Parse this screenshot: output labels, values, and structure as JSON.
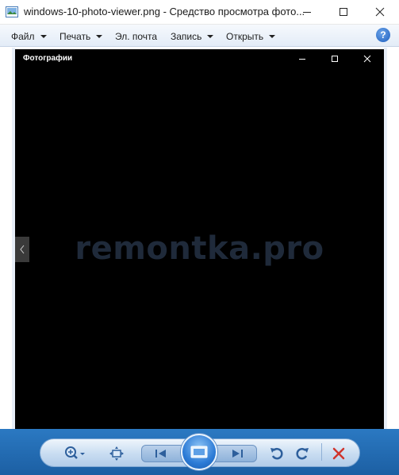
{
  "window": {
    "title": "windows-10-photo-viewer.png - Средство просмотра фото...",
    "icon": "photo-viewer-app-icon"
  },
  "menu": {
    "items": [
      {
        "label": "Файл"
      },
      {
        "label": "Печать"
      },
      {
        "label": "Эл. почта"
      },
      {
        "label": "Запись"
      },
      {
        "label": "Открыть"
      }
    ],
    "help_label": "?"
  },
  "photo": {
    "app_title": "Фотографии",
    "watermark": "remontka.pro",
    "background": "#000000",
    "watermark_color": "#1f2a3a"
  },
  "toolbar": {
    "icons": [
      "zoom-icon",
      "fit-to-window-icon",
      "previous-icon",
      "slideshow-icon",
      "next-icon",
      "rotate-left-icon",
      "rotate-right-icon",
      "delete-icon"
    ],
    "accent": "#1c5fa3",
    "delete_color": "#d0342c"
  }
}
